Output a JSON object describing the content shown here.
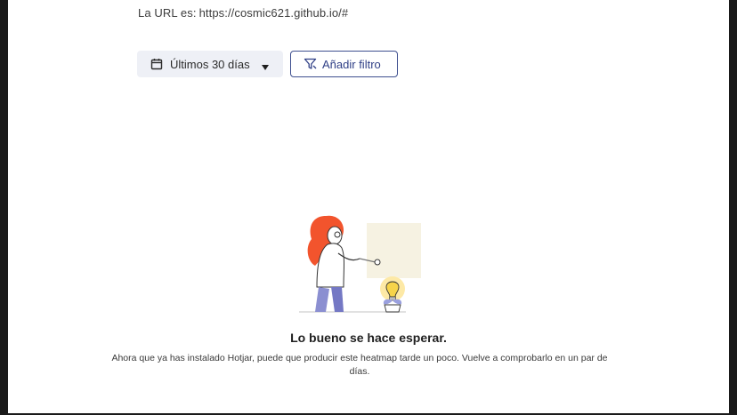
{
  "header": {
    "url_label": "La URL es:",
    "url_value": "https://cosmic621.github.io/#"
  },
  "toolbar": {
    "date_range_label": "Últimos 30 días",
    "add_filter_label": "Añadir filtro"
  },
  "empty_state": {
    "title": "Lo bueno se hace esperar.",
    "description": "Ahora que ya has instalado Hotjar, puede que producir este heatmap tarde un poco. Vuelve a comprobarlo en un par de días."
  },
  "icons": {
    "date": "calendar-icon",
    "dropdown": "caret-down-icon",
    "filter": "funnel-icon"
  },
  "colors": {
    "accent": "#2f3f86",
    "button_bg": "#eef0f6",
    "hair": "#f2542d",
    "bulb": "#f7d44a"
  }
}
